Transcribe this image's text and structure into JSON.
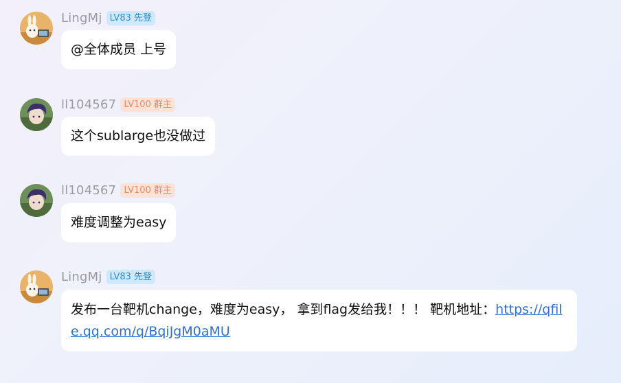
{
  "messages": [
    {
      "name": "LingMj",
      "badge": "LV83 先登",
      "badge_color": "blue",
      "avatar": "bunny-avatar",
      "text": "@全体成员 上号"
    },
    {
      "name": "ll104567",
      "badge": "LV100 群主",
      "badge_color": "orange",
      "avatar": "anime-boy-avatar",
      "text": "这个sublarge也没做过"
    },
    {
      "name": "ll104567",
      "badge": "LV100 群主",
      "badge_color": "orange",
      "avatar": "anime-boy-avatar",
      "text": "难度调整为easy"
    },
    {
      "name": "LingMj",
      "badge": "LV83 先登",
      "badge_color": "blue",
      "avatar": "bunny-avatar",
      "text": "发布一台靶机change，难度为easy， 拿到flag发给我！！！ 靶机地址：",
      "link": "https://qfile.qq.com/q/BqiJgM0aMU"
    }
  ],
  "colors": {
    "badge_blue_bg": "#cfe8fb",
    "badge_blue_text": "#2e8fd6",
    "badge_orange_bg": "#fde3d7",
    "badge_orange_text": "#ef8a5e",
    "link": "#2e6fcf"
  }
}
